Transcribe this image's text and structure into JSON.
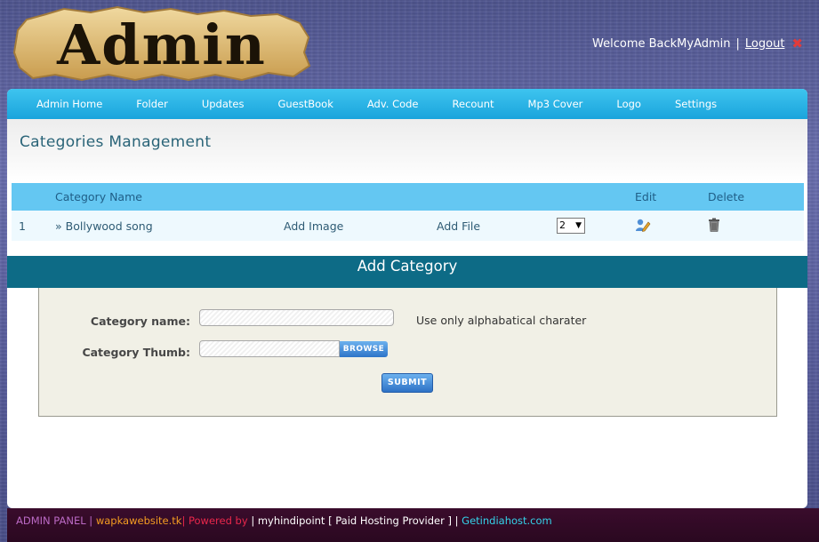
{
  "header": {
    "logo_text": "Admin",
    "welcome_text": "Welcome BackMyAdmin",
    "separator": "|",
    "logout_label": "Logout"
  },
  "nav": {
    "items": [
      {
        "label": "Admin Home"
      },
      {
        "label": "Folder"
      },
      {
        "label": "Updates"
      },
      {
        "label": "GuestBook"
      },
      {
        "label": "Adv. Code"
      },
      {
        "label": "Recount"
      },
      {
        "label": "Mp3 Cover"
      },
      {
        "label": "Logo"
      },
      {
        "label": "Settings"
      }
    ]
  },
  "page": {
    "title": "Categories Management"
  },
  "table": {
    "headers": {
      "name": "Category Name",
      "edit": "Edit",
      "delete": "Delete"
    },
    "rows": [
      {
        "index": "1",
        "name": "» Bollywood song",
        "add_image": "Add Image",
        "add_file": "Add File",
        "order_value": "2"
      }
    ]
  },
  "add_category": {
    "title": "Add Category",
    "name_label": "Category name:",
    "name_value": "",
    "name_hint": "Use only alphabatical charater",
    "thumb_label": "Category Thumb:",
    "browse_label": "BROWSE",
    "submit_label": "SUBMIT"
  },
  "footer": {
    "admin_panel": "ADMIN PANEL |",
    "site": "wapkawebsite.tk",
    "powered_by": "| Powered by",
    "provider": "| myhindipoint [ Paid Hosting Provider ] |",
    "host": "Getindiahost.com"
  },
  "colors": {
    "nav_bg": "#1aa4dc",
    "table_head_bg": "#64c7f2",
    "add_bar_bg": "#0d6b86",
    "footer_bg": "#2a0820",
    "logout_icon": "#e23b3b"
  }
}
